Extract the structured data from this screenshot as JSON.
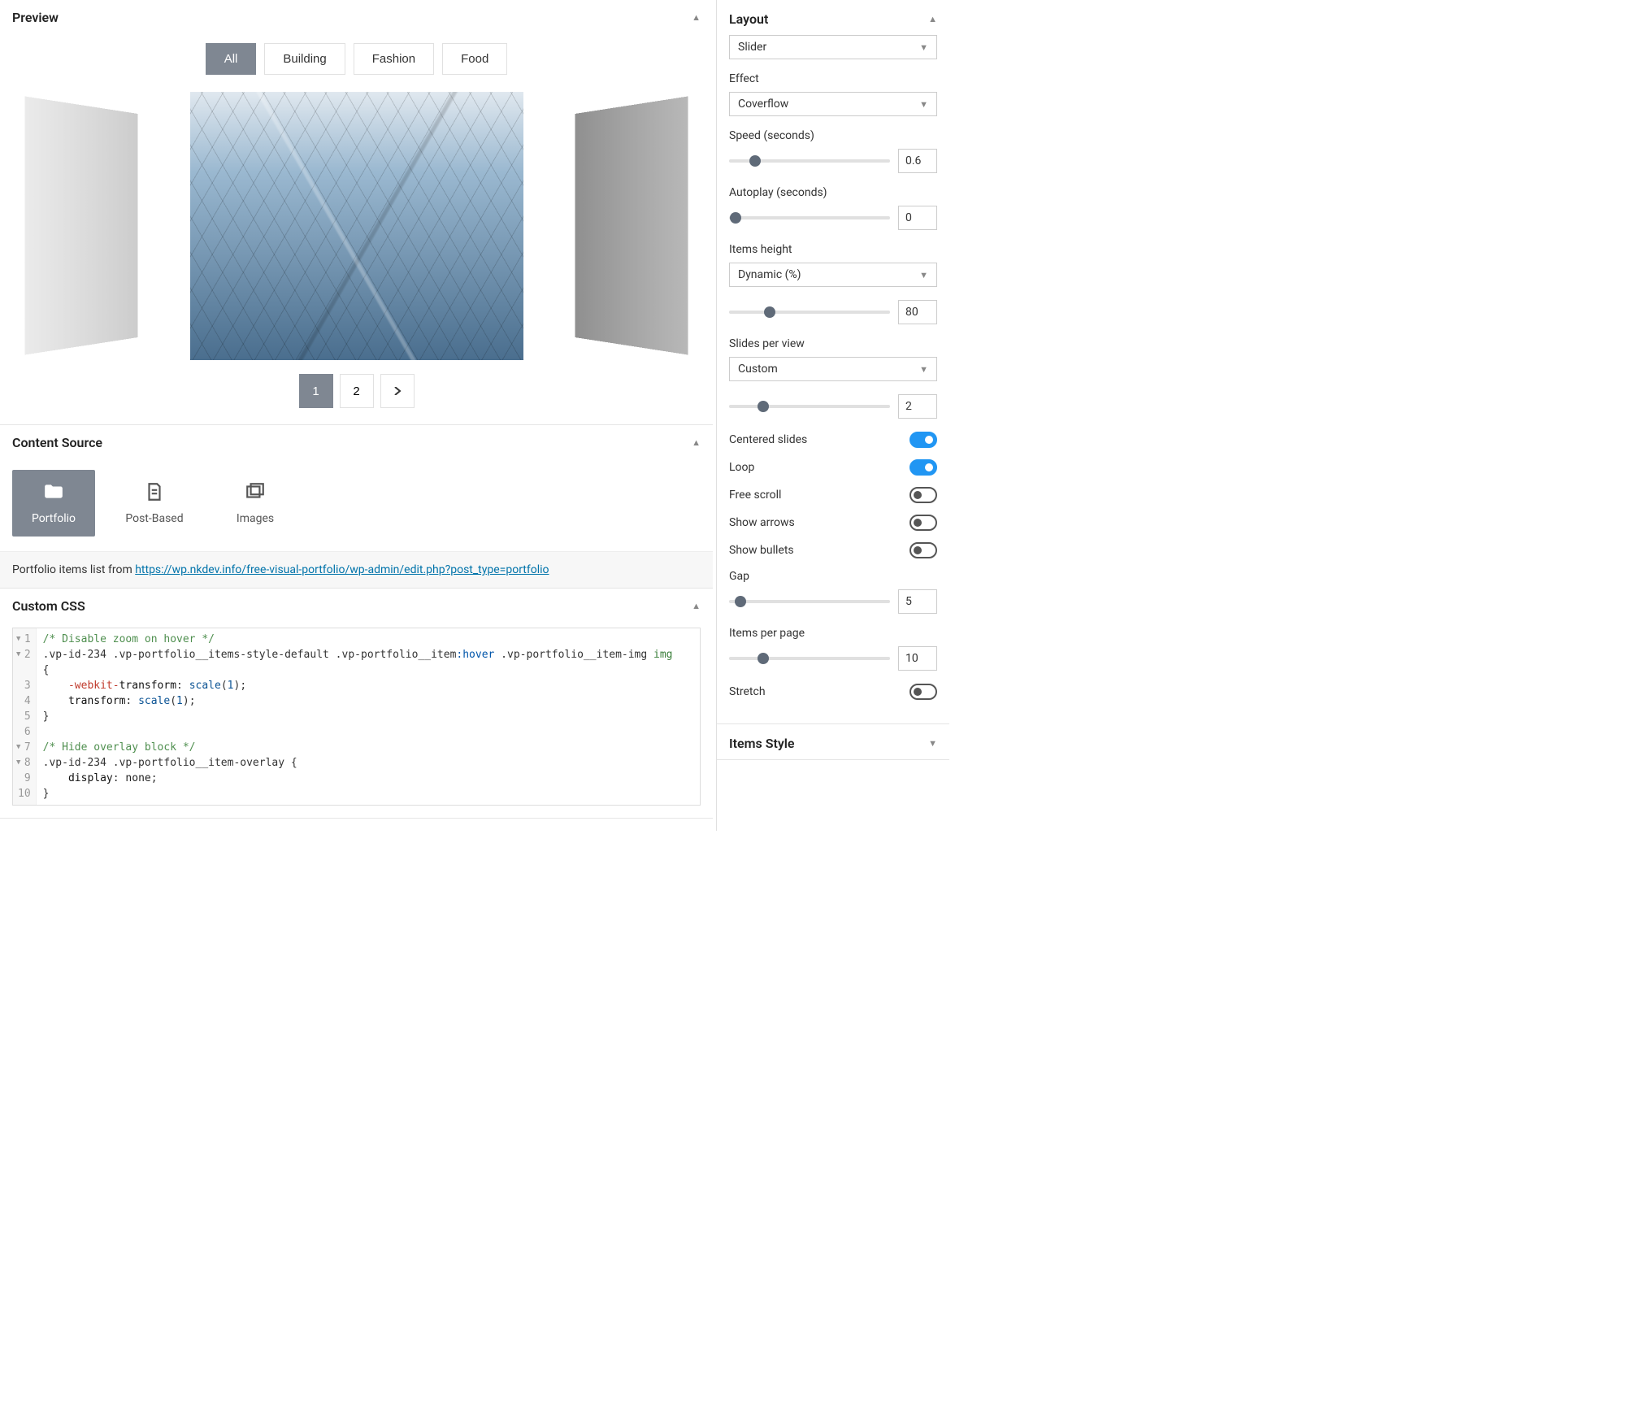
{
  "preview": {
    "title": "Preview",
    "filters": [
      "All",
      "Building",
      "Fashion",
      "Food"
    ],
    "activeFilter": 0,
    "pages": [
      "1",
      "2"
    ],
    "activePage": 0
  },
  "contentSource": {
    "title": "Content Source",
    "items": [
      {
        "label": "Portfolio",
        "icon": "folder"
      },
      {
        "label": "Post-Based",
        "icon": "page"
      },
      {
        "label": "Images",
        "icon": "images"
      }
    ],
    "activeIndex": 0,
    "noteText": "Portfolio items list from ",
    "noteLink": "https://wp.nkdev.info/free-visual-portfolio/wp-admin/edit.php?post_type=portfolio"
  },
  "customCss": {
    "title": "Custom CSS",
    "lines": [
      {
        "n": 1,
        "fold": true,
        "tokens": [
          [
            "comment",
            "/* Disable zoom on hover */"
          ]
        ]
      },
      {
        "n": 2,
        "fold": true,
        "tokens": [
          [
            "sel",
            ".vp-id-234 .vp-portfolio__items-style-default .vp-portfolio__item"
          ],
          [
            "pseudo",
            ":hover"
          ],
          [
            "sel",
            " .vp-portfolio__item-img "
          ],
          [
            "tag",
            "img"
          ]
        ]
      },
      {
        "n": "",
        "tokens": [
          [
            "brace",
            "{"
          ]
        ]
      },
      {
        "n": 3,
        "tokens": [
          [
            "indent",
            "    "
          ],
          [
            "vendor",
            "-webkit-"
          ],
          [
            "prop",
            "transform"
          ],
          [
            "sel",
            ": "
          ],
          [
            "kw",
            "scale"
          ],
          [
            "brace",
            "("
          ],
          [
            "num",
            "1"
          ],
          [
            "brace",
            ")"
          ],
          [
            "sel",
            ";"
          ]
        ]
      },
      {
        "n": 4,
        "tokens": [
          [
            "indent",
            "    "
          ],
          [
            "prop",
            "transform"
          ],
          [
            "sel",
            ": "
          ],
          [
            "kw",
            "scale"
          ],
          [
            "brace",
            "("
          ],
          [
            "num",
            "1"
          ],
          [
            "brace",
            ")"
          ],
          [
            "sel",
            ";"
          ]
        ]
      },
      {
        "n": 5,
        "tokens": [
          [
            "brace",
            "}"
          ]
        ]
      },
      {
        "n": 6,
        "tokens": []
      },
      {
        "n": 7,
        "fold": true,
        "tokens": [
          [
            "comment",
            "/* Hide overlay block */"
          ]
        ]
      },
      {
        "n": 8,
        "fold": true,
        "tokens": [
          [
            "sel",
            ".vp-id-234 .vp-portfolio__item-overlay "
          ],
          [
            "brace",
            "{"
          ]
        ]
      },
      {
        "n": 9,
        "tokens": [
          [
            "indent",
            "    "
          ],
          [
            "prop",
            "display"
          ],
          [
            "sel",
            ": "
          ],
          [
            "str",
            "none"
          ],
          [
            "sel",
            ";"
          ]
        ]
      },
      {
        "n": 10,
        "tokens": [
          [
            "brace",
            "}"
          ]
        ]
      }
    ]
  },
  "layout": {
    "title": "Layout",
    "typeLabel": "",
    "typeValue": "Slider",
    "effectLabel": "Effect",
    "effectValue": "Coverflow",
    "speedLabel": "Speed (seconds)",
    "speedValue": "0.6",
    "speedPercent": 16,
    "autoplayLabel": "Autoplay (seconds)",
    "autoplayValue": "0",
    "autoplayPercent": 4,
    "itemsHeightLabel": "Items height",
    "itemsHeightValue": "Dynamic (%)",
    "itemsHeightSlider": "80",
    "itemsHeightPercent": 25,
    "slidesPerViewLabel": "Slides per view",
    "slidesPerViewValue": "Custom",
    "slidesPerViewSlider": "2",
    "slidesPerViewPercent": 21,
    "toggles": [
      {
        "label": "Centered slides",
        "on": true
      },
      {
        "label": "Loop",
        "on": true
      },
      {
        "label": "Free scroll",
        "on": false
      },
      {
        "label": "Show arrows",
        "on": false
      },
      {
        "label": "Show bullets",
        "on": false
      }
    ],
    "gapLabel": "Gap",
    "gapValue": "5",
    "gapPercent": 7,
    "itemsPerPageLabel": "Items per page",
    "itemsPerPageValue": "10",
    "itemsPerPagePercent": 21,
    "stretchLabel": "Stretch",
    "stretchOn": false
  },
  "itemsStyle": {
    "title": "Items Style"
  }
}
